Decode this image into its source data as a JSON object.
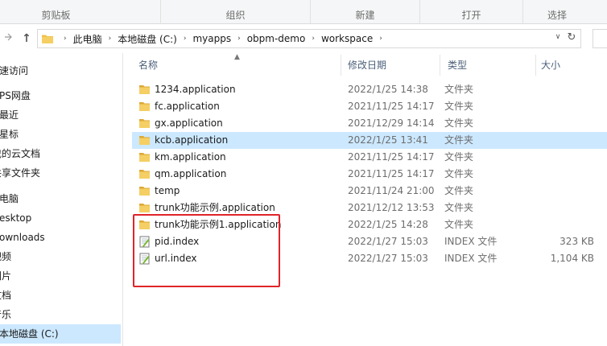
{
  "ribbon": {
    "groups": [
      "剪贴板",
      "组织",
      "新建",
      "打开",
      "选择"
    ]
  },
  "nav": {
    "back_icon": "arrow-left-icon",
    "forward_icon": "arrow-right-icon",
    "up_icon": "arrow-up-icon",
    "up_glyph": "↑",
    "dropdown_glyph": "∨",
    "refresh_glyph": "↻",
    "crumb_sep": "›",
    "breadcrumbs": [
      "此电脑",
      "本地磁盘 (C:)",
      "myapps",
      "obpm-demo",
      "workspace"
    ]
  },
  "sidebar": {
    "items": [
      {
        "label": "速访问",
        "icon": "star-icon"
      },
      {
        "label": "PS网盘",
        "icon": "cloud-icon"
      },
      {
        "label": "最近",
        "icon": "clock-icon"
      },
      {
        "label": "星标",
        "icon": "star-icon"
      },
      {
        "label": "我的云文档",
        "icon": "cloud-icon"
      },
      {
        "label": "共享文件夹",
        "icon": "share-icon"
      },
      {
        "label": "电脑",
        "icon": "pc-icon"
      },
      {
        "label": "esktop",
        "icon": "desktop-icon"
      },
      {
        "label": "ownloads",
        "icon": "download-icon"
      },
      {
        "label": "视频",
        "icon": "video-icon"
      },
      {
        "label": "图片",
        "icon": "image-icon"
      },
      {
        "label": "文档",
        "icon": "document-icon"
      },
      {
        "label": "音乐",
        "icon": "music-icon"
      },
      {
        "label": "本地磁盘 (C:)",
        "icon": "drive-icon",
        "selected": true
      }
    ]
  },
  "columns": {
    "name": "名称",
    "date": "修改日期",
    "type": "类型",
    "size": "大小"
  },
  "files": [
    {
      "name": "1234.application",
      "date": "2022/1/25 14:38",
      "type": "文件夹",
      "size": "",
      "kind": "folder"
    },
    {
      "name": "fc.application",
      "date": "2021/11/25 14:17",
      "type": "文件夹",
      "size": "",
      "kind": "folder"
    },
    {
      "name": "gx.application",
      "date": "2021/12/29 14:14",
      "type": "文件夹",
      "size": "",
      "kind": "folder"
    },
    {
      "name": "kcb.application",
      "date": "2022/1/25 13:41",
      "type": "文件夹",
      "size": "",
      "kind": "folder",
      "selected": true
    },
    {
      "name": "km.application",
      "date": "2021/11/25 14:17",
      "type": "文件夹",
      "size": "",
      "kind": "folder"
    },
    {
      "name": "qm.application",
      "date": "2021/11/25 14:17",
      "type": "文件夹",
      "size": "",
      "kind": "folder"
    },
    {
      "name": "temp",
      "date": "2021/11/24 21:00",
      "type": "文件夹",
      "size": "",
      "kind": "folder"
    },
    {
      "name": "trunk功能示例.application",
      "date": "2021/12/12 13:53",
      "type": "文件夹",
      "size": "",
      "kind": "folder"
    },
    {
      "name": "trunk功能示例1.application",
      "date": "2022/1/25 14:28",
      "type": "文件夹",
      "size": "",
      "kind": "folder"
    },
    {
      "name": "pid.index",
      "date": "2022/1/27 15:03",
      "type": "INDEX 文件",
      "size": "323 KB",
      "kind": "file"
    },
    {
      "name": "url.index",
      "date": "2022/1/27 15:03",
      "type": "INDEX 文件",
      "size": "1,104 KB",
      "kind": "file"
    }
  ],
  "colors": {
    "folder": "#f0c24b",
    "folder_dark": "#dca835",
    "selection": "#cce8ff",
    "annotation_box": "#e0242a"
  }
}
